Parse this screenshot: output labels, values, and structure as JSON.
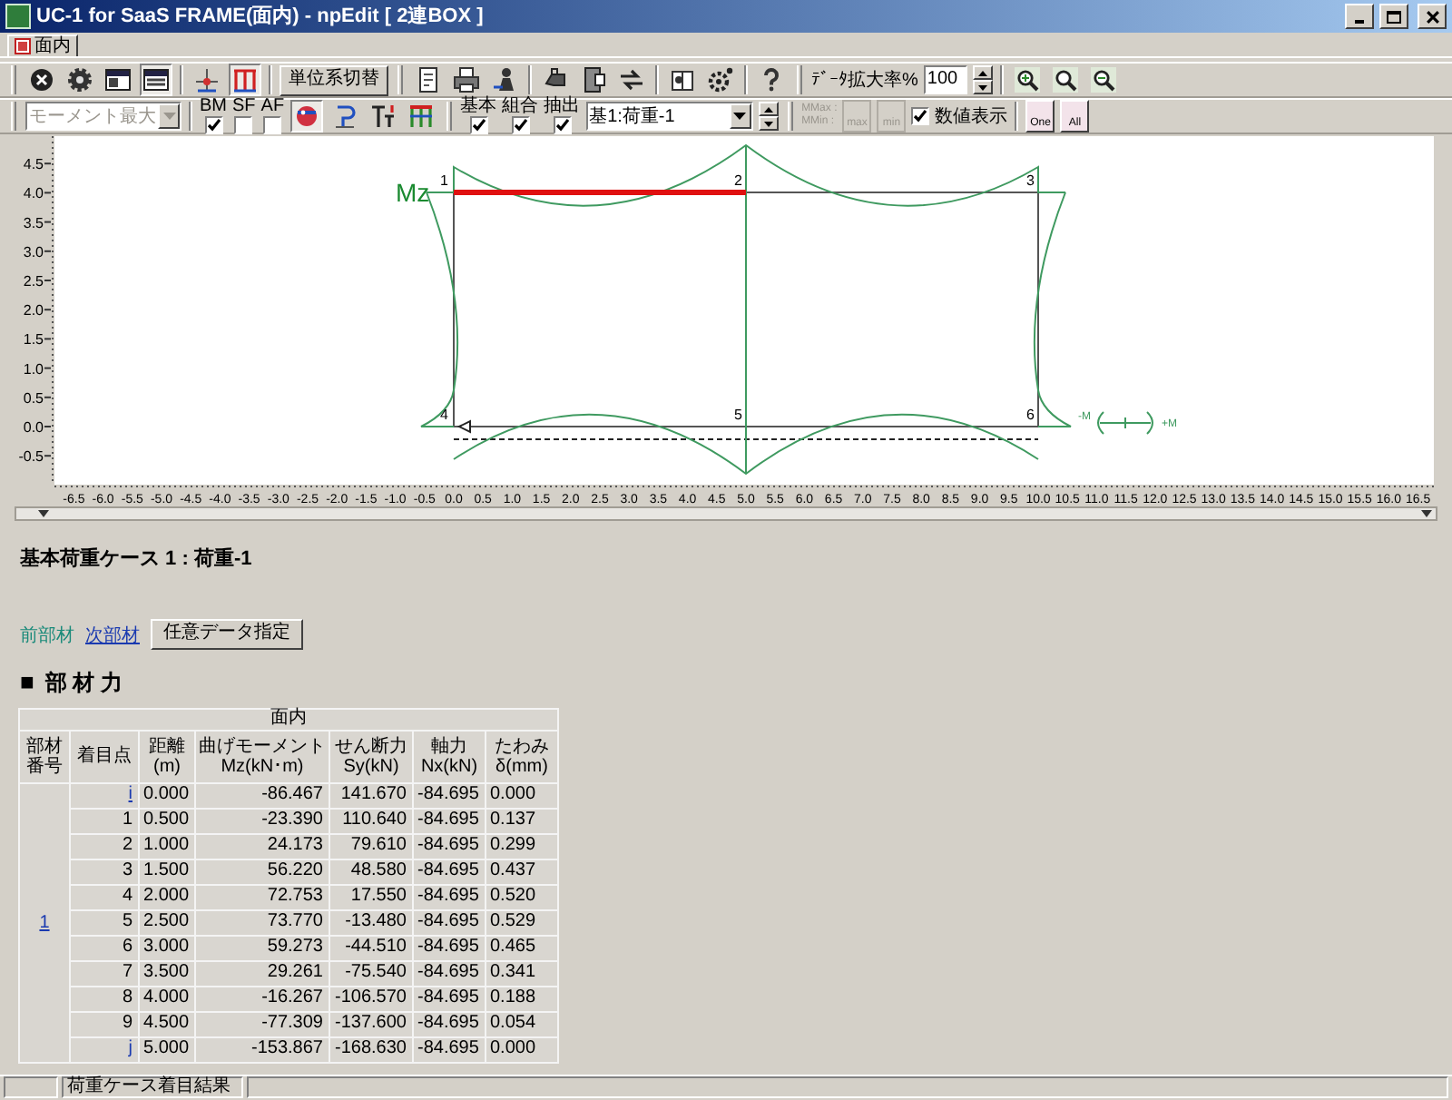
{
  "window": {
    "title": "UC-1 for SaaS FRAME(面内) - npEdit [ 2連BOX ]"
  },
  "tabs": [
    {
      "label": "面内",
      "selected": true
    }
  ],
  "toolbar_1": [
    {
      "kind": "grip"
    },
    {
      "kind": "icon",
      "pressed": false
    },
    {
      "kind": "icon",
      "pressed": false
    },
    {
      "kind": "icon",
      "pressed": false
    },
    {
      "kind": "icon",
      "pressed": true
    },
    {
      "kind": "sep"
    },
    {
      "kind": "icon",
      "pressed": false
    },
    {
      "kind": "icon",
      "pressed": true
    },
    {
      "kind": "sep"
    },
    {
      "kind": "button",
      "label": "単位系切替"
    },
    {
      "kind": "grip"
    },
    {
      "kind": "icon",
      "pressed": false
    },
    {
      "kind": "icon",
      "pressed": false
    },
    {
      "kind": "icon",
      "pressed": false
    },
    {
      "kind": "sep"
    },
    {
      "kind": "icon",
      "pressed": false
    },
    {
      "kind": "icon",
      "pressed": false
    },
    {
      "kind": "icon",
      "pressed": false
    },
    {
      "kind": "sep"
    },
    {
      "kind": "icon",
      "pressed": false
    },
    {
      "kind": "icon",
      "pressed": false
    },
    {
      "kind": "sep"
    },
    {
      "kind": "icon",
      "pressed": false
    },
    {
      "kind": "grip"
    },
    {
      "kind": "label",
      "text": "ﾃﾞｰﾀ拡大率%"
    },
    {
      "kind": "spin",
      "value": "100"
    },
    {
      "kind": "sep"
    },
    {
      "kind": "icon",
      "pressed": false
    },
    {
      "kind": "icon",
      "pressed": false
    },
    {
      "kind": "icon",
      "pressed": false
    }
  ],
  "toolbar_2": [
    {
      "kind": "grip"
    },
    {
      "kind": "select",
      "value": "モーメント最大",
      "disabled": true
    },
    {
      "kind": "sep"
    },
    {
      "kind": "check",
      "label": "BM",
      "checked": true
    },
    {
      "kind": "check",
      "label": "SF",
      "checked": false
    },
    {
      "kind": "check",
      "label": "AF",
      "checked": false
    },
    {
      "kind": "icon",
      "pressed": true
    },
    {
      "kind": "icon",
      "pressed": false
    },
    {
      "kind": "icon",
      "pressed": false
    },
    {
      "kind": "icon",
      "pressed": false
    },
    {
      "kind": "grip"
    },
    {
      "kind": "check",
      "label": "基本",
      "checked": true
    },
    {
      "kind": "check",
      "label": "組合",
      "checked": true
    },
    {
      "kind": "check",
      "label": "抽出",
      "checked": true
    },
    {
      "kind": "select",
      "value": "基1:荷重-1",
      "disabled": false
    },
    {
      "kind": "spinner"
    },
    {
      "kind": "grip"
    },
    {
      "kind": "stack",
      "lines": [
        "MMax :",
        "MMin :"
      ]
    },
    {
      "kind": "text_button",
      "label": "max",
      "disabled": true
    },
    {
      "kind": "text_button",
      "label": "min",
      "disabled": true
    },
    {
      "kind": "check_inline",
      "label": "数値表示",
      "checked": true
    },
    {
      "kind": "sep"
    },
    {
      "kind": "text_button",
      "label": "One",
      "disabled": false
    },
    {
      "kind": "text_button",
      "label": "All",
      "disabled": false
    }
  ],
  "diagram": {
    "moment_label": "Mz",
    "nodes": [
      "1",
      "2",
      "3",
      "4",
      "5",
      "6"
    ],
    "y_ticks": [
      "4.5",
      "4.0",
      "3.5",
      "3.0",
      "2.5",
      "2.0",
      "1.5",
      "1.0",
      "0.5",
      "0.0",
      "-0.5"
    ],
    "x_ticks": [
      "-6.5",
      "-6.0",
      "-5.5",
      "-5.0",
      "-4.5",
      "-4.0",
      "-3.5",
      "-3.0",
      "-2.5",
      "-2.0",
      "-1.5",
      "-1.0",
      "-0.5",
      "0.0",
      "0.5",
      "1.0",
      "1.5",
      "2.0",
      "2.5",
      "3.0",
      "3.5",
      "4.0",
      "4.5",
      "5.0",
      "5.5",
      "6.0",
      "6.5",
      "7.0",
      "7.5",
      "8.0",
      "8.5",
      "9.0",
      "9.5",
      "10.0",
      "10.5",
      "11.0",
      "11.5",
      "12.0",
      "12.5",
      "13.0",
      "13.5",
      "14.0",
      "14.5",
      "15.0",
      "15.5",
      "16.0",
      "16.5"
    ],
    "legend_minus": "-M",
    "legend_plus": "+M"
  },
  "case_title": "基本荷重ケース 1 : 荷重-1",
  "member_links": [
    {
      "label": "前部材",
      "disabled": true
    },
    {
      "label": "次部材",
      "disabled": false
    }
  ],
  "data_button": "任意データ指定",
  "section": {
    "bullet": "■",
    "title": "部 材 力"
  },
  "table": {
    "group": "面内",
    "columns": [
      {
        "name": "部材番号"
      },
      {
        "name": "着目点"
      },
      {
        "name": "距離",
        "unit": "(m)"
      },
      {
        "name": "曲げモーメント",
        "unit": "Mz(kN･m)"
      },
      {
        "name": "せん断力",
        "unit": "Sy(kN)"
      },
      {
        "name": "軸力",
        "unit": "Nx(kN)"
      },
      {
        "name": "たわみ",
        "unit": "δ(mm)"
      }
    ],
    "member": "1",
    "rows": [
      {
        "point": "i",
        "link": true,
        "distance": "0.000",
        "mz": "-86.467",
        "sy": "141.670",
        "nx": "-84.695",
        "delta": "0.000"
      },
      {
        "point": "1",
        "link": false,
        "distance": "0.500",
        "mz": "-23.390",
        "sy": "110.640",
        "nx": "-84.695",
        "delta": "0.137"
      },
      {
        "point": "2",
        "link": false,
        "distance": "1.000",
        "mz": "24.173",
        "sy": "79.610",
        "nx": "-84.695",
        "delta": "0.299"
      },
      {
        "point": "3",
        "link": false,
        "distance": "1.500",
        "mz": "56.220",
        "sy": "48.580",
        "nx": "-84.695",
        "delta": "0.437"
      },
      {
        "point": "4",
        "link": false,
        "distance": "2.000",
        "mz": "72.753",
        "sy": "17.550",
        "nx": "-84.695",
        "delta": "0.520"
      },
      {
        "point": "5",
        "link": false,
        "distance": "2.500",
        "mz": "73.770",
        "sy": "-13.480",
        "nx": "-84.695",
        "delta": "0.529"
      },
      {
        "point": "6",
        "link": false,
        "distance": "3.000",
        "mz": "59.273",
        "sy": "-44.510",
        "nx": "-84.695",
        "delta": "0.465"
      },
      {
        "point": "7",
        "link": false,
        "distance": "3.500",
        "mz": "29.261",
        "sy": "-75.540",
        "nx": "-84.695",
        "delta": "0.341"
      },
      {
        "point": "8",
        "link": false,
        "distance": "4.000",
        "mz": "-16.267",
        "sy": "-106.570",
        "nx": "-84.695",
        "delta": "0.188"
      },
      {
        "point": "9",
        "link": false,
        "distance": "4.500",
        "mz": "-77.309",
        "sy": "-137.600",
        "nx": "-84.695",
        "delta": "0.054"
      },
      {
        "point": "j",
        "link": true,
        "distance": "5.000",
        "mz": "-153.867",
        "sy": "-168.630",
        "nx": "-84.695",
        "delta": "0.000"
      }
    ]
  },
  "status_bar": [
    "荷重ケース着目結果"
  ]
}
